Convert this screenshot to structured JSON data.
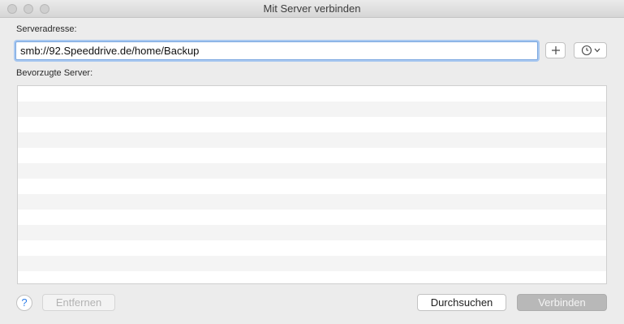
{
  "window": {
    "title": "Mit Server verbinden"
  },
  "address": {
    "label": "Serveradresse:",
    "value": "smb://92.Speeddrive.de/home/Backup"
  },
  "add_button": {
    "icon": "plus-icon"
  },
  "history_button": {
    "icon": "clock-icon"
  },
  "favorites": {
    "label": "Bevorzugte Server:",
    "items": []
  },
  "footer": {
    "help_label": "?",
    "remove_label": "Entfernen",
    "browse_label": "Durchsuchen",
    "connect_label": "Verbinden"
  },
  "colors": {
    "accent": "#2d7de8",
    "focus_ring": "#a9c8f0"
  }
}
